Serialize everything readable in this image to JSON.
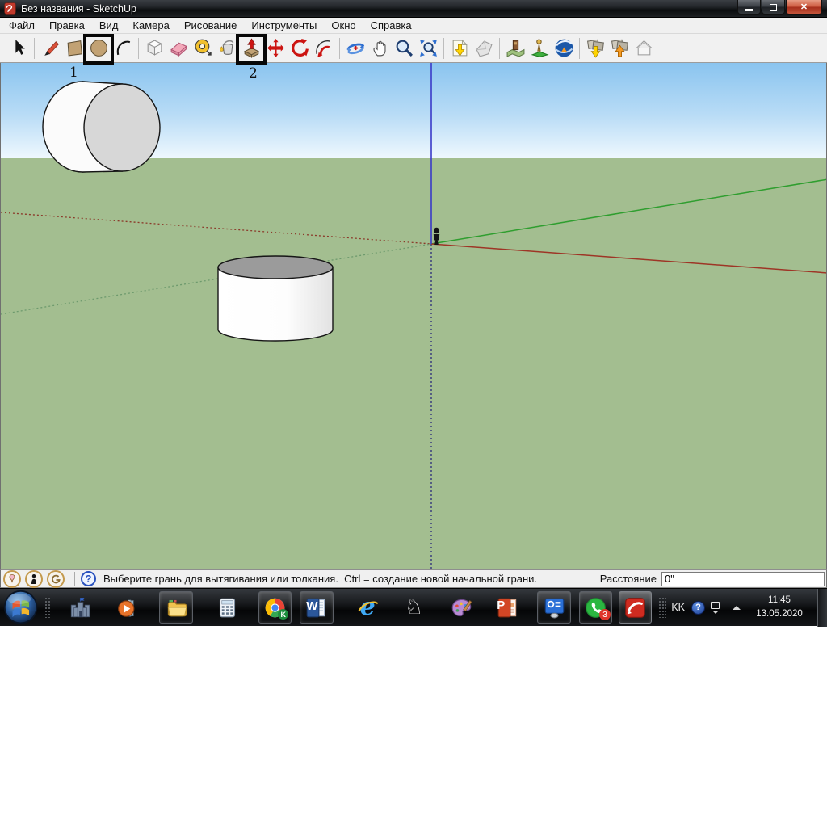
{
  "window": {
    "title": "Без названия - SketchUp"
  },
  "icons": {
    "close": "✕",
    "question": "?",
    "word_letter": "W",
    "powerpoint_letter": "P",
    "ie_letter": "e",
    "chess_piece": "♘"
  },
  "menu": {
    "items": [
      "Файл",
      "Правка",
      "Вид",
      "Камера",
      "Рисование",
      "Инструменты",
      "Окно",
      "Справка"
    ]
  },
  "toolbar": {
    "tools": [
      "select",
      "line",
      "rectangle",
      "circle",
      "arc",
      "make-component",
      "eraser",
      "tape-measure",
      "paint-bucket",
      "push-pull",
      "move",
      "rotate",
      "offset",
      "orbit",
      "pan",
      "zoom",
      "zoom-extents",
      "get-models",
      "share-model",
      "add-location",
      "position-camera",
      "google-earth",
      "photo-textures-down",
      "photo-textures-up",
      "toggle-terrain"
    ]
  },
  "annotations": {
    "label_1": "1",
    "label_2": "2"
  },
  "viewport": {
    "colors": {
      "sky_top": "#8ac4ef",
      "sky_bottom": "#eef8fe",
      "ground": "#a3be90",
      "axis_red": "#9e3526",
      "axis_green": "#2f9e2f",
      "axis_blue": "#3a3ac8"
    },
    "objects": [
      "lying-cylinder",
      "standing-cylinder",
      "person-figure"
    ]
  },
  "statusbar": {
    "help_text": "Выберите грань для вытягивания или толкания.  Ctrl = создание новой начальной грани.",
    "distance_label": "Расстояние",
    "distance_value": "0\""
  },
  "taskbar": {
    "language": "KK",
    "whatsapp_badge": "3",
    "chrome_badge": "K",
    "time": "11:45",
    "date": "13.05.2020"
  }
}
